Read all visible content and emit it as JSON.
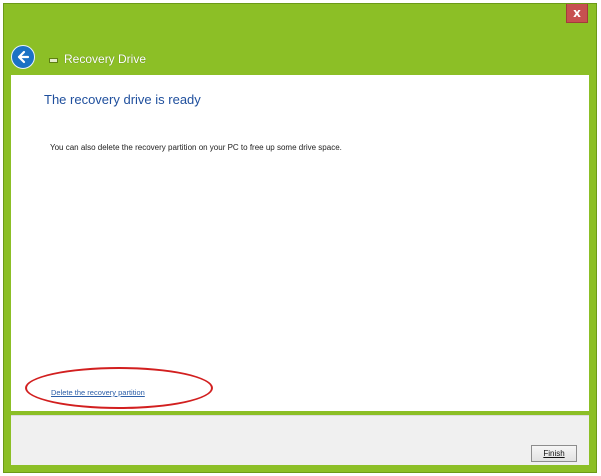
{
  "window": {
    "title": "Recovery Drive",
    "close_label": "x",
    "accent_color": "#8cbf26"
  },
  "icons": {
    "back": "back-arrow-icon",
    "drive": "drive-icon",
    "close": "close-icon"
  },
  "content": {
    "heading": "The recovery drive is ready",
    "body": "You can also delete the recovery partition on your PC to free up some drive space.",
    "delete_link": "Delete the recovery partition"
  },
  "footer": {
    "finish_label": "Finish"
  },
  "annotation": {
    "highlight_color": "#d21f1f"
  }
}
